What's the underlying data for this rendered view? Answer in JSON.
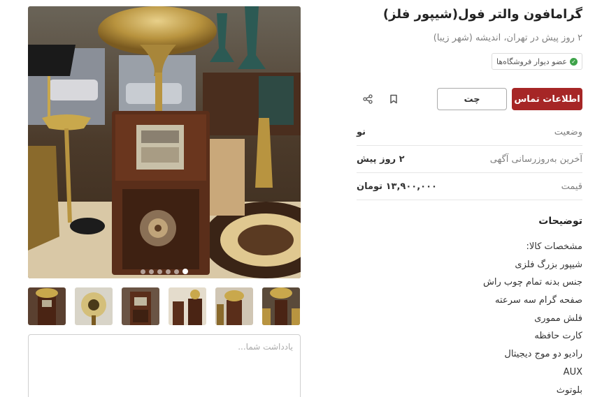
{
  "listing": {
    "title": "گرامافون والتر فول(شیپور فلز)",
    "subtitle": "۲ روز پیش در تهران، اندیشه (شهر زیبا)",
    "badge": "عضو دیوار فروشگاه‌ها"
  },
  "actions": {
    "contact_label": "اطلاعات تماس",
    "chat_label": "چت",
    "bookmark_icon": "bookmark-icon",
    "share_icon": "share-icon"
  },
  "details": [
    {
      "key": "وضعیت",
      "value": "نو"
    },
    {
      "key": "آخرین به‌روزرسانی آگهی",
      "value": "۲ روز پیش"
    },
    {
      "key": "قیمت",
      "value": "۱۳,۹۰۰,۰۰۰ تومان"
    }
  ],
  "description": {
    "title": "توضیحات",
    "lines": [
      "مشخصات کالا:",
      "شیپور بزرگ فلزی",
      "جنس بدنه تمام چوب راش",
      "صفحه گرام سه سرعته",
      "فلش مموری",
      "کارت حافظه",
      "رادیو دو موج دیجیتال",
      "AUX",
      "بلوتوث"
    ]
  },
  "gallery": {
    "image_count": 6,
    "active_index": 5
  },
  "note": {
    "placeholder": "یادداشت شما..."
  },
  "colors": {
    "accent": "#a62626",
    "verified": "#3ea34a"
  }
}
